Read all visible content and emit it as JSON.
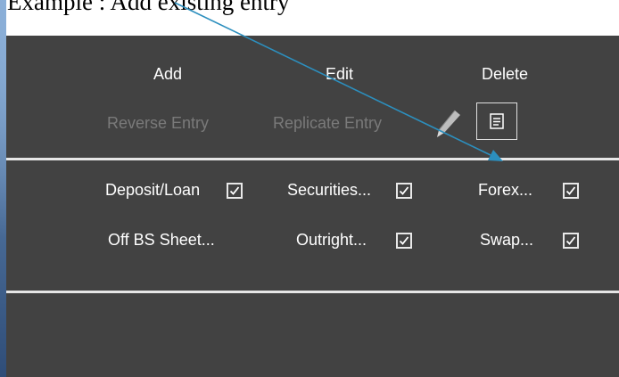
{
  "caption": "Example : Add existing entry",
  "toolbar": {
    "add_label": "Add",
    "edit_label": "Edit",
    "delete_label": "Delete",
    "reverse_entry_label": "Reverse Entry",
    "replicate_entry_label": "Replicate Entry"
  },
  "filters": [
    {
      "label": "Deposit/Loan",
      "checked": true
    },
    {
      "label": "Securities...",
      "checked": true
    },
    {
      "label": "Forex...",
      "checked": true
    },
    {
      "label": "Off BS Sheet...",
      "checked": false
    },
    {
      "label": "Outright...",
      "checked": true
    },
    {
      "label": "Swap...",
      "checked": true
    }
  ],
  "icons": [
    "pencil-icon",
    "note-icon",
    "checkmark-icon"
  ],
  "colors": {
    "panel": "#424242",
    "text": "#ffffff",
    "disabled_text": "#7a7a7a",
    "arrow": "#2c8fbe"
  }
}
